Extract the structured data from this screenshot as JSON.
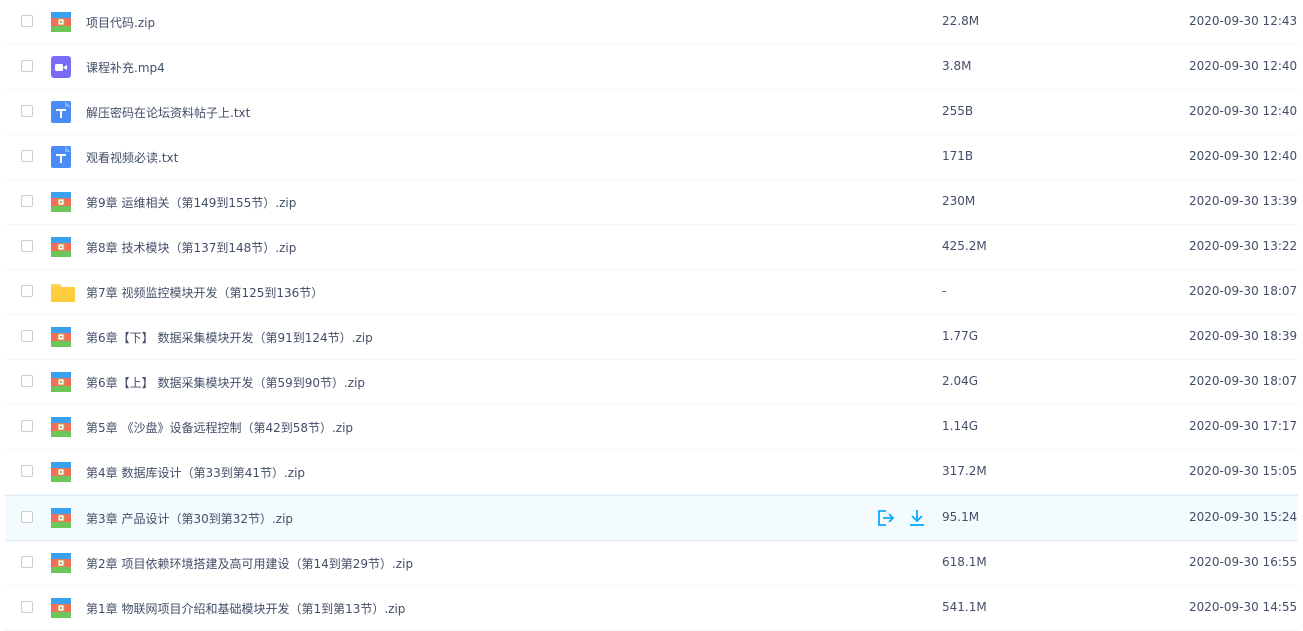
{
  "files": [
    {
      "name": "项目代码.zip",
      "type": "zip",
      "size": "22.8M",
      "date": "2020-09-30 12:43"
    },
    {
      "name": "课程补充.mp4",
      "type": "video",
      "size": "3.8M",
      "date": "2020-09-30 12:40"
    },
    {
      "name": "解压密码在论坛资料帖子上.txt",
      "type": "txt",
      "size": "255B",
      "date": "2020-09-30 12:40"
    },
    {
      "name": "观看视频必读.txt",
      "type": "txt",
      "size": "171B",
      "date": "2020-09-30 12:40"
    },
    {
      "name": "第9章 运维相关（第149到155节）.zip",
      "type": "zip",
      "size": "230M",
      "date": "2020-09-30 13:39"
    },
    {
      "name": "第8章 技术模块（第137到148节）.zip",
      "type": "zip",
      "size": "425.2M",
      "date": "2020-09-30 13:22"
    },
    {
      "name": "第7章 视频监控模块开发（第125到136节）",
      "type": "folder",
      "size": "-",
      "date": "2020-09-30 18:07"
    },
    {
      "name": "第6章【下】 数据采集模块开发（第91到124节）.zip",
      "type": "zip",
      "size": "1.77G",
      "date": "2020-09-30 18:39"
    },
    {
      "name": "第6章【上】 数据采集模块开发（第59到90节）.zip",
      "type": "zip",
      "size": "2.04G",
      "date": "2020-09-30 18:07"
    },
    {
      "name": "第5章 《沙盘》设备远程控制（第42到58节）.zip",
      "type": "zip",
      "size": "1.14G",
      "date": "2020-09-30 17:17"
    },
    {
      "name": "第4章 数据库设计（第33到第41节）.zip",
      "type": "zip",
      "size": "317.2M",
      "date": "2020-09-30 15:05"
    },
    {
      "name": "第3章 产品设计（第30到第32节）.zip",
      "type": "zip",
      "size": "95.1M",
      "date": "2020-09-30 15:24",
      "hover": true
    },
    {
      "name": "第2章 项目依赖环境搭建及高可用建设（第14到第29节）.zip",
      "type": "zip",
      "size": "618.1M",
      "date": "2020-09-30 16:55"
    },
    {
      "name": "第1章 物联网项目介绍和基础模块开发（第1到第13节）.zip",
      "type": "zip",
      "size": "541.1M",
      "date": "2020-09-30 14:55"
    }
  ],
  "colors": {
    "accent": "#09aaff",
    "text": "#424e67",
    "folder": "#ffd659",
    "txt": "#4a8cf7",
    "video": "#7b6cf6"
  }
}
